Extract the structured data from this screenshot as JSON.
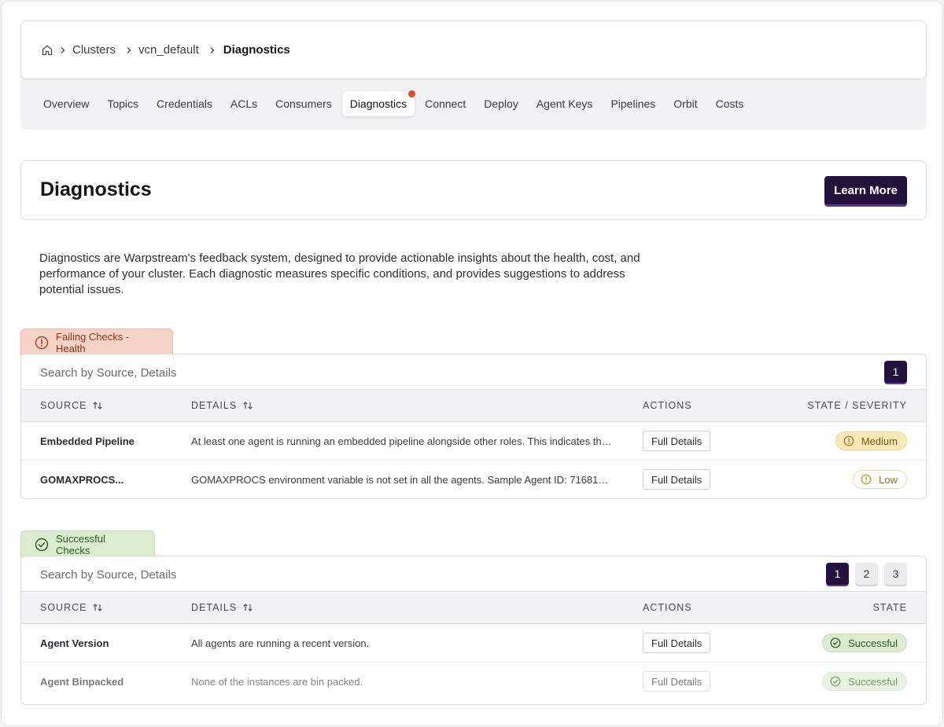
{
  "breadcrumb": {
    "items": [
      "Clusters",
      "vcn_default"
    ],
    "current": "Diagnostics"
  },
  "tabs": [
    {
      "label": "Overview"
    },
    {
      "label": "Topics"
    },
    {
      "label": "Credentials"
    },
    {
      "label": "ACLs"
    },
    {
      "label": "Consumers"
    },
    {
      "label": "Diagnostics",
      "active": true,
      "notification": true
    },
    {
      "label": "Connect"
    },
    {
      "label": "Deploy"
    },
    {
      "label": "Agent Keys"
    },
    {
      "label": "Pipelines"
    },
    {
      "label": "Orbit"
    },
    {
      "label": "Costs"
    }
  ],
  "page": {
    "title": "Diagnostics",
    "learn_more_label": "Learn More",
    "description": "Diagnostics are Warpstream's feedback system, designed to provide actionable insights about the health, cost, and performance of your cluster. Each diagnostic measures specific conditions, and provides suggestions to address potential issues."
  },
  "failing": {
    "label": "Failing Checks - Health",
    "search_placeholder": "Search by Source, Details",
    "pages": [
      "1"
    ],
    "active_page": "1",
    "columns": {
      "source": "SOURCE",
      "details": "DETAILS",
      "actions": "ACTIONS",
      "state": "STATE / SEVERITY"
    },
    "rows": [
      {
        "source": "Embedded Pipeline",
        "details": "At least one agent is running an embedded pipeline alongside other roles. This indicates tha...",
        "action": "Full Details",
        "severity": "Medium"
      },
      {
        "source": "GOMAXPROCS...",
        "details": "GOMAXPROCS environment variable is not set in all the agents. Sample Agent ID: 71681053...",
        "action": "Full Details",
        "severity": "Low"
      }
    ]
  },
  "successful": {
    "label": "Successful Checks",
    "search_placeholder": "Search by Source, Details",
    "pages": [
      "1",
      "2",
      "3"
    ],
    "active_page": "1",
    "columns": {
      "source": "SOURCE",
      "details": "DETAILS",
      "actions": "ACTIONS",
      "state": "STATE"
    },
    "rows": [
      {
        "source": "Agent Version",
        "details": "All agents are running a recent version.",
        "action": "Full Details",
        "state": "Successful"
      },
      {
        "source": "Agent Binpacked",
        "details": "None of the instances are bin packed.",
        "action": "Full Details",
        "state": "Successful"
      }
    ]
  },
  "colors": {
    "brand": "#24113d",
    "notification_dot": "#e5482b",
    "fail_tab_bg": "#f6d3c7",
    "ok_tab_bg": "#dcecd1",
    "medium_badge_bg": "#fbe7b8"
  },
  "icons": {
    "home": "home-icon",
    "breadcrumb_separator": "chevron-right-icon",
    "failing": "alert-circle-icon",
    "successful": "check-circle-icon",
    "sort": "sort-arrows-icon"
  }
}
